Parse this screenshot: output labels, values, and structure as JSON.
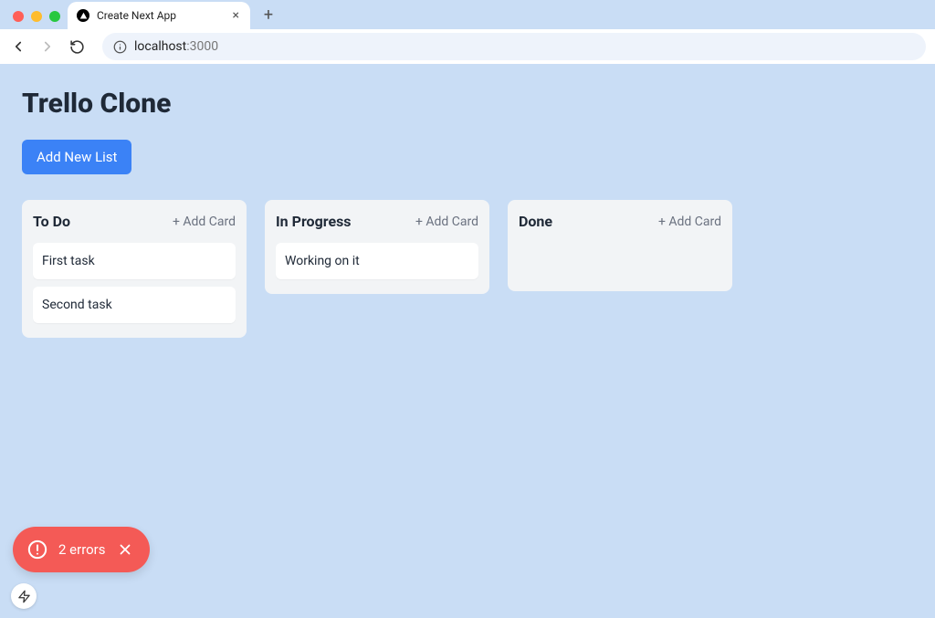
{
  "browser": {
    "tab_title": "Create Next App",
    "url_host": "localhost",
    "url_port": ":3000"
  },
  "page": {
    "title": "Trello Clone",
    "add_list_label": "Add New List",
    "add_card_label": "+ Add Card"
  },
  "lists": [
    {
      "title": "To Do",
      "cards": [
        "First task",
        "Second task"
      ]
    },
    {
      "title": "In Progress",
      "cards": [
        "Working on it"
      ]
    },
    {
      "title": "Done",
      "cards": []
    }
  ],
  "error_toast": {
    "text": "2 errors"
  }
}
